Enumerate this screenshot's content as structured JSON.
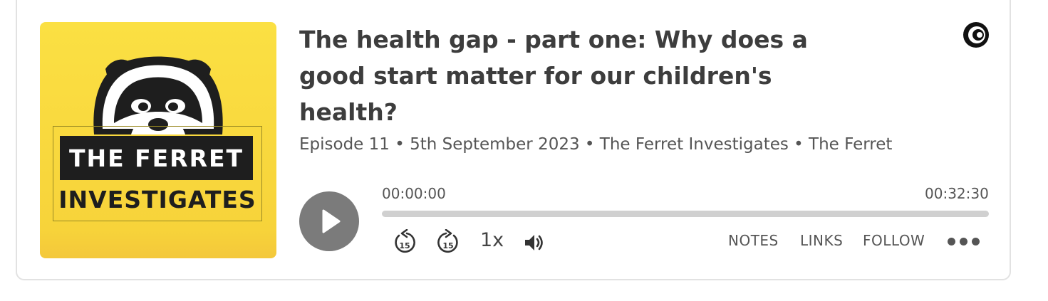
{
  "episode": {
    "title": "The health gap - part one: Why does a good start matter for our children's health?",
    "meta": "Episode 11 • 5th September 2023 • The Ferret Investigates • The Ferret"
  },
  "cover": {
    "line1": "THE FERRET",
    "line2": "INVESTIGATES",
    "background": "#fbe043"
  },
  "player": {
    "current_time": "00:00:00",
    "duration": "00:32:30",
    "progress_fraction": 0,
    "speed_label": "1x",
    "skip_back_seconds": "15",
    "skip_forward_seconds": "15"
  },
  "menu": {
    "notes": "NOTES",
    "links": "LINKS",
    "follow": "FOLLOW"
  },
  "icons": {
    "play": "play-icon",
    "rewind": "rewind-15-icon",
    "forward": "forward-15-icon",
    "volume": "volume-icon",
    "more": "more-icon",
    "brand": "captivate-logo-icon"
  },
  "colors": {
    "play_button": "#7b7b7b",
    "progress_track": "#d0d0d0",
    "text": "#3d3d3d"
  }
}
